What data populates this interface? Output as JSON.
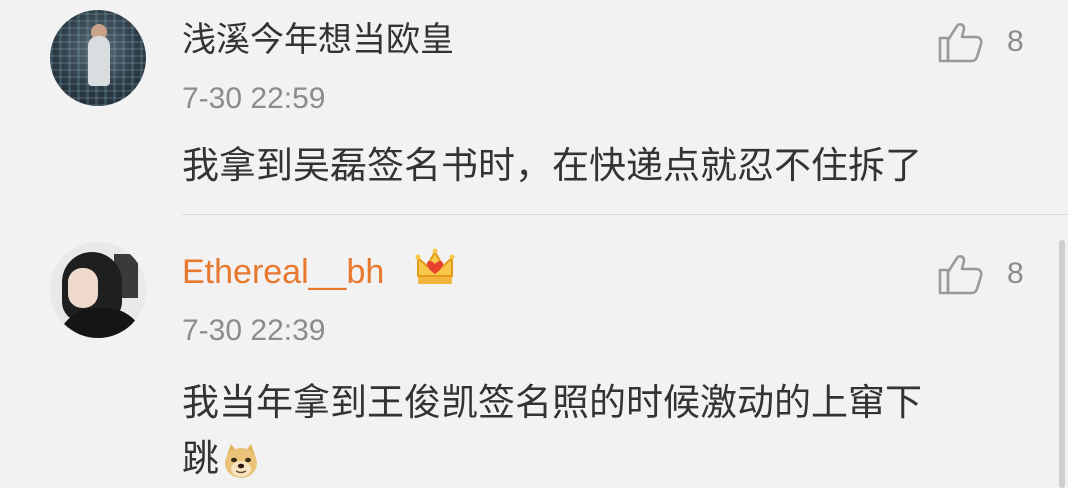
{
  "comments": [
    {
      "username": "浅溪今年想当欧皇",
      "time": "7-30 22:59",
      "likes": "8",
      "text": "我拿到吴磊签名书时，在快递点就忍不住拆了",
      "avatar_icon": "user-avatar-photo"
    },
    {
      "username": "Ethereal__bh",
      "badge_icon": "vip-crown-icon",
      "time": "7-30 22:39",
      "likes": "8",
      "text_line1": "我当年拿到王俊凯签名照的时候激动的上窜下",
      "text_line2": "跳",
      "emoji_icon": "doge-emoji-icon",
      "avatar_icon": "user-avatar-photo"
    }
  ],
  "colors": {
    "background": "#f2f2f2",
    "vip_name": "#e8782e",
    "text": "#333333",
    "secondary": "#8c8c8c"
  }
}
